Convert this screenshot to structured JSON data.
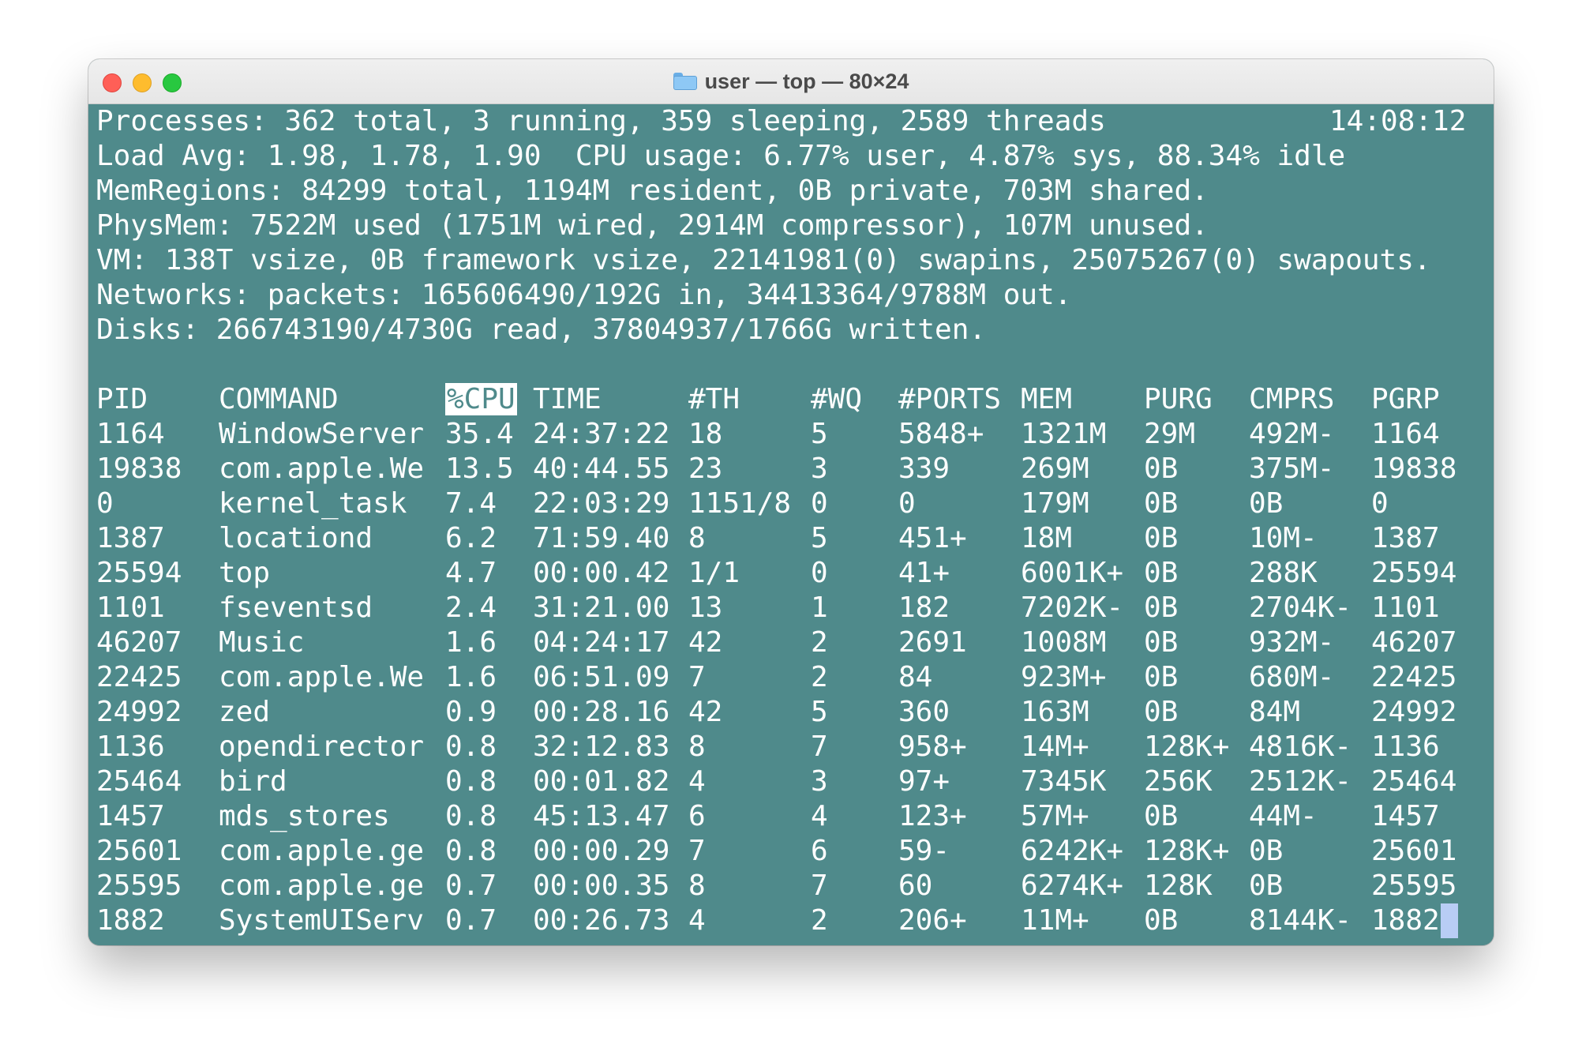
{
  "window": {
    "title": "user — top — 80×24",
    "title_icon": "folder-icon",
    "colors": {
      "terminal_bg": "#4f8a8b",
      "text": "#ffffff",
      "cursor": "#b8cdf5"
    }
  },
  "summary": {
    "processes": "Processes: 362 total, 3 running, 359 sleeping, 2589 threads",
    "time": "14:08:12",
    "load": "Load Avg: 1.98, 1.78, 1.90  CPU usage: 6.77% user, 4.87% sys, 88.34% idle",
    "memregions": "MemRegions: 84299 total, 1194M resident, 0B private, 703M shared.",
    "physmem": "PhysMem: 7522M used (1751M wired, 2914M compressor), 107M unused.",
    "vm": "VM: 138T vsize, 0B framework vsize, 22141981(0) swapins, 25075267(0) swapouts.",
    "networks": "Networks: packets: 165606490/192G in, 34413364/9788M out.",
    "disks": "Disks: 266743190/4730G read, 37804937/1766G written."
  },
  "table": {
    "headers": [
      "PID",
      "COMMAND",
      "%CPU",
      "TIME",
      "#TH",
      "#WQ",
      "#PORTS",
      "MEM",
      "PURG",
      "CMPRS",
      "PGRP"
    ],
    "sorted_column": "%CPU",
    "rows": [
      [
        "1164",
        "WindowServer",
        "35.4",
        "24:37:22",
        "18",
        "5",
        "5848+",
        "1321M",
        "29M",
        "492M-",
        "1164"
      ],
      [
        "19838",
        "com.apple.We",
        "13.5",
        "40:44.55",
        "23",
        "3",
        "339",
        "269M",
        "0B",
        "375M-",
        "19838"
      ],
      [
        "0",
        "kernel_task",
        "7.4",
        "22:03:29",
        "1151/8",
        "0",
        "0",
        "179M",
        "0B",
        "0B",
        "0"
      ],
      [
        "1387",
        "locationd",
        "6.2",
        "71:59.40",
        "8",
        "5",
        "451+",
        "18M",
        "0B",
        "10M-",
        "1387"
      ],
      [
        "25594",
        "top",
        "4.7",
        "00:00.42",
        "1/1",
        "0",
        "41+",
        "6001K+",
        "0B",
        "288K",
        "25594"
      ],
      [
        "1101",
        "fseventsd",
        "2.4",
        "31:21.00",
        "13",
        "1",
        "182",
        "7202K-",
        "0B",
        "2704K-",
        "1101"
      ],
      [
        "46207",
        "Music",
        "1.6",
        "04:24:17",
        "42",
        "2",
        "2691",
        "1008M",
        "0B",
        "932M-",
        "46207"
      ],
      [
        "22425",
        "com.apple.We",
        "1.6",
        "06:51.09",
        "7",
        "2",
        "84",
        "923M+",
        "0B",
        "680M-",
        "22425"
      ],
      [
        "24992",
        "zed",
        "0.9",
        "00:28.16",
        "42",
        "5",
        "360",
        "163M",
        "0B",
        "84M",
        "24992"
      ],
      [
        "1136",
        "opendirector",
        "0.8",
        "32:12.83",
        "8",
        "7",
        "958+",
        "14M+",
        "128K+",
        "4816K-",
        "1136"
      ],
      [
        "25464",
        "bird",
        "0.8",
        "00:01.82",
        "4",
        "3",
        "97+",
        "7345K",
        "256K",
        "2512K-",
        "25464"
      ],
      [
        "1457",
        "mds_stores",
        "0.8",
        "45:13.47",
        "6",
        "4",
        "123+",
        "57M+",
        "0B",
        "44M-",
        "1457"
      ],
      [
        "25601",
        "com.apple.ge",
        "0.8",
        "00:00.29",
        "7",
        "6",
        "59-",
        "6242K+",
        "128K+",
        "0B",
        "25601"
      ],
      [
        "25595",
        "com.apple.ge",
        "0.7",
        "00:00.35",
        "8",
        "7",
        "60",
        "6274K+",
        "128K",
        "0B",
        "25595"
      ],
      [
        "1882",
        "SystemUIServ",
        "0.7",
        "00:26.73",
        "4",
        "2",
        "206+",
        "11M+",
        "0B",
        "8144K-",
        "1882"
      ]
    ]
  }
}
